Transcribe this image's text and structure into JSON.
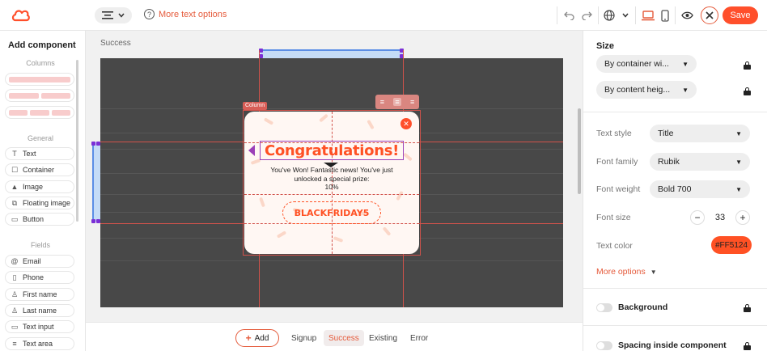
{
  "topbar": {
    "more_text_label": "More text options",
    "save_label": "Save",
    "accent": "#FF4F2B"
  },
  "left_panel": {
    "title": "Add component",
    "sections": {
      "columns": "Columns",
      "general": "General",
      "fields": "Fields"
    },
    "general_items": [
      {
        "label": "Text",
        "icon": "text-icon"
      },
      {
        "label": "Container",
        "icon": "container-icon"
      },
      {
        "label": "Image",
        "icon": "image-icon"
      },
      {
        "label": "Floating image",
        "icon": "floating-image-icon"
      },
      {
        "label": "Button",
        "icon": "button-icon"
      }
    ],
    "field_items": [
      {
        "label": "Email",
        "icon": "at-icon"
      },
      {
        "label": "Phone",
        "icon": "phone-icon"
      },
      {
        "label": "First name",
        "icon": "person-icon"
      },
      {
        "label": "Last name",
        "icon": "person-icon"
      },
      {
        "label": "Text input",
        "icon": "input-icon"
      },
      {
        "label": "Text area",
        "icon": "textarea-icon"
      }
    ]
  },
  "canvas": {
    "breadcrumb": "Success",
    "column_tag": "Column",
    "popup": {
      "title": "Congratulations!",
      "body": "You've Won! Fantastic news! You've just unlocked a special prize:",
      "prize": "10%",
      "coupon": "BLACKFRIDAY5"
    }
  },
  "bottom_bar": {
    "add_label": "Add",
    "tabs": [
      "Signup",
      "Success",
      "Existing",
      "Error"
    ],
    "active_tab": "Success"
  },
  "right_panel": {
    "size_title": "Size",
    "width_mode": "By container wi...",
    "height_mode": "By content heig...",
    "text_style_label": "Text style",
    "text_style_value": "Title",
    "font_family_label": "Font family",
    "font_family_value": "Rubik",
    "font_weight_label": "Font weight",
    "font_weight_value": "Bold 700",
    "font_size_label": "Font size",
    "font_size_value": "33",
    "text_color_label": "Text color",
    "text_color_value": "#FF5124",
    "more_options_label": "More options",
    "background_label": "Background",
    "spacing_label": "Spacing inside component"
  }
}
